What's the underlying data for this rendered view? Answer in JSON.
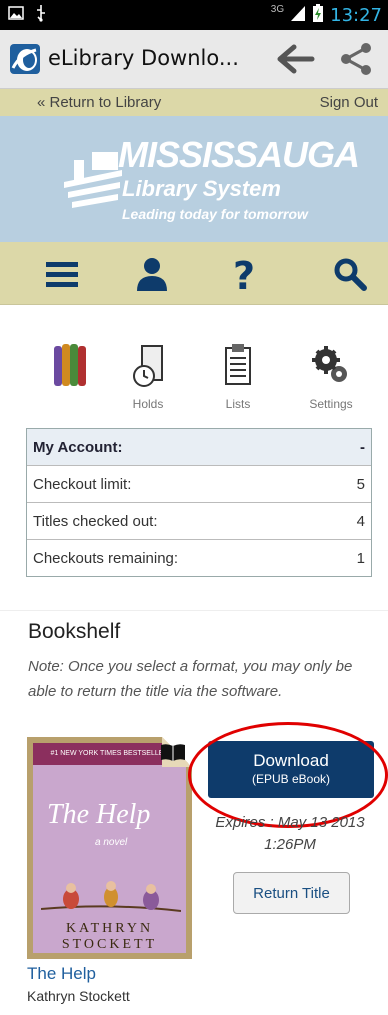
{
  "status_bar": {
    "network": "3G",
    "time": "13:27"
  },
  "action_bar": {
    "title": "eLibrary Downlo..."
  },
  "links": {
    "return": "« Return to Library",
    "signout": "Sign Out"
  },
  "banner": {
    "line1": "MISSISSAUGA",
    "line2": "Library System",
    "line3": "Leading today for tomorrow"
  },
  "shortcuts": [
    {
      "label": ""
    },
    {
      "label": "Holds"
    },
    {
      "label": "Lists"
    },
    {
      "label": "Settings"
    }
  ],
  "account": {
    "header": {
      "label": "My Account:",
      "value": "-"
    },
    "rows": [
      {
        "label": "Checkout limit:",
        "value": "5"
      },
      {
        "label": "Titles checked out:",
        "value": "4"
      },
      {
        "label": "Checkouts remaining:",
        "value": "1"
      }
    ]
  },
  "bookshelf": {
    "title": "Bookshelf",
    "note": "Note: Once you select a format, you may only be able to return the title via the software."
  },
  "book": {
    "cover_top": "#1 NEW YORK TIMES BESTSELLER",
    "cover_title": "The Help",
    "cover_subtitle": "a novel",
    "cover_author_first": "KATHRYN",
    "cover_author_last": "STOCKETT",
    "download_label": "Download",
    "download_format": "(EPUB eBook)",
    "expires": "Expires : May 13 2013 1:26PM",
    "return_label": "Return Title",
    "title": "The Help",
    "author": "Kathryn Stockett"
  },
  "colors": {
    "accent": "#0e3b6b",
    "nav_bg": "#dcd8a8",
    "banner_bg": "#b8cfe0",
    "highlight": "#e00000"
  }
}
